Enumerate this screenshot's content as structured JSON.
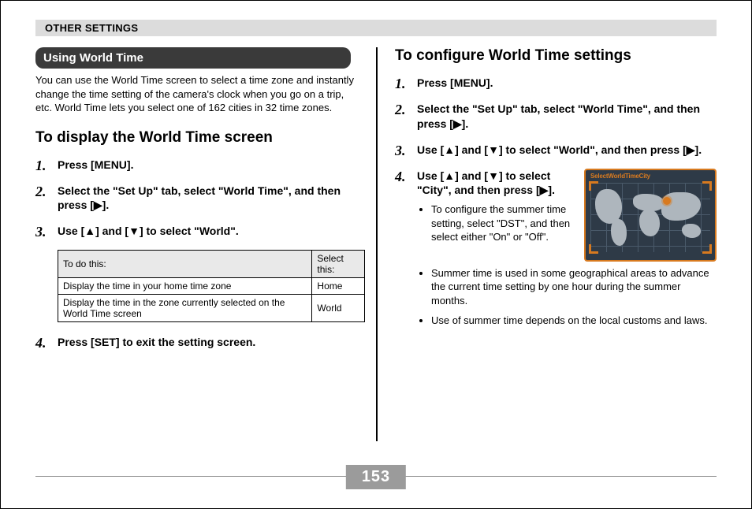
{
  "header": {
    "section_title": "OTHER SETTINGS"
  },
  "left": {
    "pill_title": "Using World Time",
    "intro": "You can use the World Time screen to select a time zone and instantly change the time setting of the camera's clock when you go on a trip, etc. World Time lets you select one of 162 cities in 32 time zones.",
    "h2": "To display the World Time screen",
    "steps": {
      "s1_num": "1.",
      "s1": "Press [MENU].",
      "s2_num": "2.",
      "s2": "Select the \"Set Up\" tab, select \"World Time\", and then press [▶].",
      "s3_num": "3.",
      "s3": "Use [▲] and [▼] to select \"World\".",
      "s4_num": "4.",
      "s4": "Press [SET] to exit the setting screen."
    },
    "table": {
      "h1": "To do this:",
      "h2": "Select this:",
      "r1c1": "Display the time in your home time zone",
      "r1c2": "Home",
      "r2c1": "Display the time in the zone currently selected on the World Time screen",
      "r2c2": "World"
    }
  },
  "right": {
    "h2": "To configure World Time settings",
    "steps": {
      "s1_num": "1.",
      "s1": "Press [MENU].",
      "s2_num": "2.",
      "s2": "Select the \"Set Up\" tab, select \"World Time\", and then press [▶].",
      "s3_num": "3.",
      "s3": "Use [▲] and [▼] to select \"World\", and then press [▶].",
      "s4_num": "4.",
      "s4": "Use [▲] and [▼] to select \"City\", and then press [▶].",
      "bullets": {
        "b1": "To configure the summer time setting, select \"DST\", and then select either \"On\" or \"Off\".",
        "b2": "Summer time is used in some geographical areas to advance the current time setting by one hour during the summer months.",
        "b3": "Use of summer time depends on the local customs and laws."
      }
    },
    "map_title": "SelectWorldTimeCity"
  },
  "page_number": "153"
}
